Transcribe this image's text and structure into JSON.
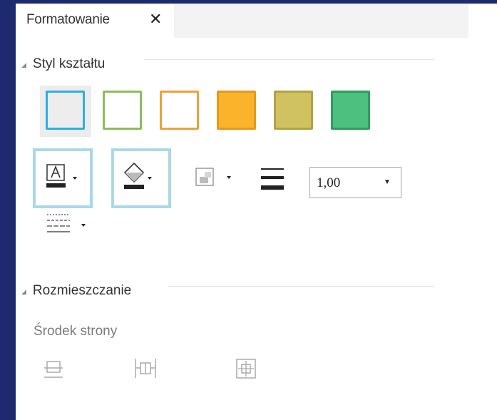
{
  "tab": {
    "title": "Formatowanie",
    "close_glyph": "✕"
  },
  "shape_style": {
    "title": "Styl kształtu",
    "swatches": [
      {
        "name": "light-blue-outline",
        "fill": "#ededed",
        "border": "#2ab0e4"
      },
      {
        "name": "green-outline",
        "fill": "#ffffff",
        "border": "#8cbd5b"
      },
      {
        "name": "orange-outline",
        "fill": "#ffffff",
        "border": "#eda13a"
      },
      {
        "name": "orange-fill",
        "fill": "#fbb32c",
        "border": "#e29a1f"
      },
      {
        "name": "olive-fill",
        "fill": "#d1c261",
        "border": "#b5a143"
      },
      {
        "name": "green-fill",
        "fill": "#4dbf7e",
        "border": "#2e9d5f"
      }
    ],
    "line_width_value": "1,00"
  },
  "arrange": {
    "title": "Rozmieszczanie",
    "center_label": "Środek strony"
  },
  "colors": {
    "highlight": "#a8d8ea",
    "background": "#1d2a6d"
  }
}
